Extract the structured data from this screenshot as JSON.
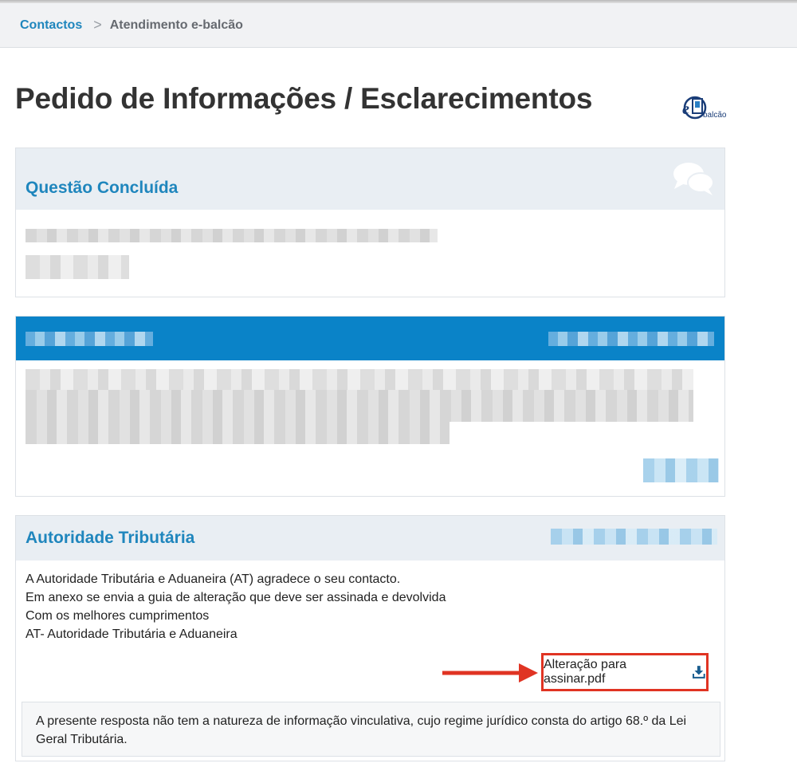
{
  "breadcrumb": {
    "link": "Contactos",
    "separator": ">",
    "current": "Atendimento e-balcão"
  },
  "page": {
    "title": "Pedido de Informações / Esclarecimentos"
  },
  "logo": {
    "mark_letter": "e",
    "text": "balcão"
  },
  "question_card": {
    "title": "Questão Concluída",
    "icon": "chat-bubbles-icon"
  },
  "answer_card": {
    "title": "Autoridade Tributária",
    "body_lines": [
      "A Autoridade Tributária e Aduaneira (AT) agradece o seu contacto.",
      "Em anexo se envia a guia de alteração que deve ser assinada e devolvida",
      "Com os melhores cumprimentos",
      "AT- Autoridade Tributária e Aduaneira"
    ],
    "attachment_label": "Alteração para assinar.pdf",
    "attachment_icon": "download-icon",
    "notice": "A presente resposta não tem a natureza de informação vinculativa, cujo regime jurídico consta do artigo 68.º da Lei Geral Tributária."
  },
  "colors": {
    "accent": "#1f86bd",
    "message_header": "#0a83c8",
    "highlight": "#e03423"
  }
}
